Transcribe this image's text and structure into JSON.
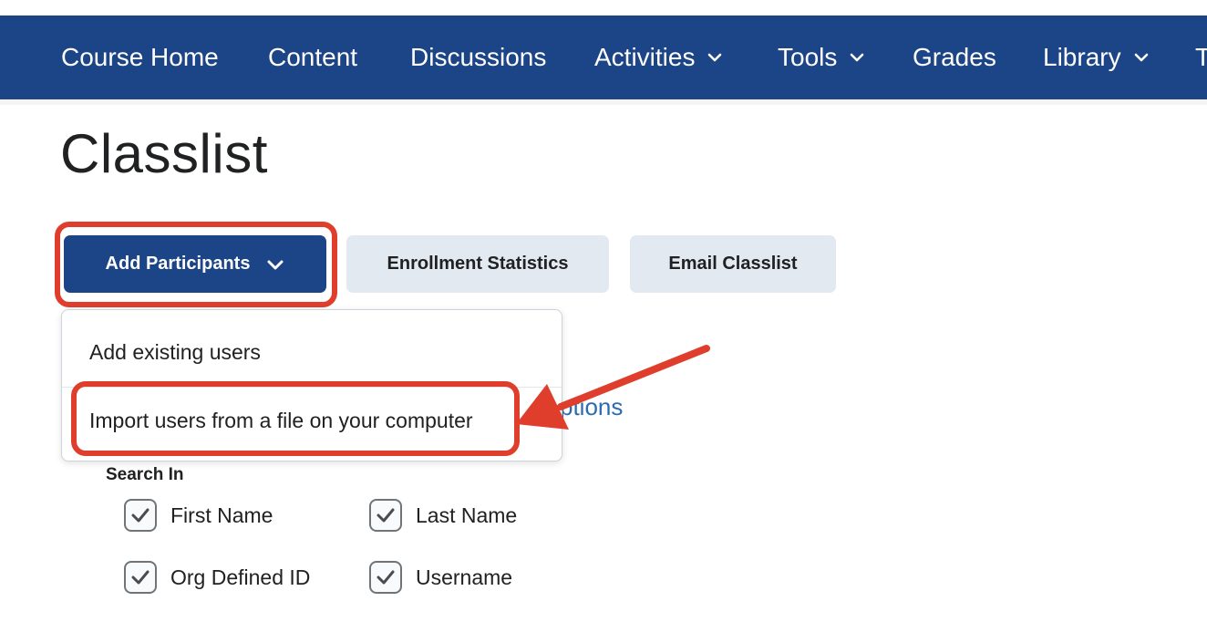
{
  "nav": {
    "items": [
      {
        "label": "Course Home",
        "dropdown": false
      },
      {
        "label": "Content",
        "dropdown": false
      },
      {
        "label": "Discussions",
        "dropdown": false
      },
      {
        "label": "Activities",
        "dropdown": true
      },
      {
        "label": "Tools",
        "dropdown": true
      },
      {
        "label": "Grades",
        "dropdown": false
      },
      {
        "label": "Library",
        "dropdown": true
      },
      {
        "label": "T",
        "dropdown": false
      }
    ]
  },
  "page": {
    "title": "Classlist"
  },
  "toolbar": {
    "add_participants_label": "Add Participants",
    "enrollment_statistics_label": "Enrollment Statistics",
    "email_classlist_label": "Email Classlist"
  },
  "menu": {
    "items": [
      {
        "label": "Add existing users"
      },
      {
        "label": "Import users from a file on your computer"
      }
    ]
  },
  "options_link_partial": "ptions",
  "search": {
    "label": "Search In",
    "fields": [
      {
        "label": "First Name",
        "checked": true
      },
      {
        "label": "Last Name",
        "checked": true
      },
      {
        "label": "Org Defined ID",
        "checked": true
      },
      {
        "label": "Username",
        "checked": true
      }
    ]
  },
  "colors": {
    "nav_bg": "#1c4587",
    "primary_button": "#1c4587",
    "secondary_button": "#e3e9f1",
    "annotation_red": "#e03e2d",
    "link_blue": "#2b6cb0"
  },
  "icons": {
    "nav_dropdown": "chevron-down-icon",
    "checkbox_mark": "checkmark-icon",
    "annotation": "arrow-icon"
  }
}
